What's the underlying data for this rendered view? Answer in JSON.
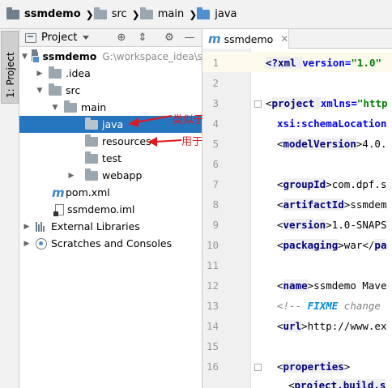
{
  "breadcrumb": [
    "ssmdemo",
    "src",
    "main",
    "java"
  ],
  "toolstrip": {
    "project_tab": "1: Project"
  },
  "project_panel": {
    "title": "Project",
    "tree": [
      {
        "label": "ssmdemo",
        "path": "G:\\workspace_idea\\s"
      },
      {
        "label": ".idea"
      },
      {
        "label": "src"
      },
      {
        "label": "main"
      },
      {
        "label": "java"
      },
      {
        "label": "resources"
      },
      {
        "label": "test"
      },
      {
        "label": "webapp"
      },
      {
        "label": "pom.xml"
      },
      {
        "label": "ssmdemo.iml"
      },
      {
        "label": "External Libraries"
      },
      {
        "label": "Scratches and Consoles"
      }
    ]
  },
  "annotations": {
    "java_note": "类似于以前的src",
    "resources_note": "用于存放xml文件"
  },
  "colors": {
    "selection": "#2675bf",
    "annotation": "#e8151b"
  },
  "editor": {
    "tab_label": "ssmdemo",
    "line_numbers": [
      "1",
      "3",
      "5",
      "6",
      "7",
      "8",
      "9",
      "10",
      "12",
      "13",
      "14",
      "15",
      "16"
    ],
    "line_numbers_full": [
      "1",
      "2",
      "3",
      "4",
      "5",
      "6",
      "7",
      "8",
      "9",
      "10",
      "11",
      "12",
      "13",
      "14",
      "15",
      "16"
    ],
    "lines": {
      "l1_a": "<?xml ",
      "l1_b": "version=",
      "l1_c": "\"1.0\"",
      "l3_a": "project ",
      "l3_b": "xmlns=",
      "l3_c": "\"http",
      "l4_a": "xsi:schemaLocation",
      "l5_a": "modelVersion",
      "l5_b": ">4.0.",
      "l7_a": "groupId",
      "l7_b": ">com.dpf.s",
      "l8_a": "artifactId",
      "l8_b": ">ssmdem",
      "l9_a": "version",
      "l9_b": ">1.0-SNAPS",
      "l10_a": "packaging",
      "l10_b": ">war</",
      "l10_c": "pa",
      "l12_a": "name",
      "l12_b": ">ssmdemo Mave",
      "l13_a": "<!-- ",
      "l13_b": "FIXME",
      "l13_c": " change",
      "l14_a": "url",
      "l14_b": ">http://www.ex",
      "l16_a": "properties",
      "l17_a": "project.build.s"
    }
  }
}
